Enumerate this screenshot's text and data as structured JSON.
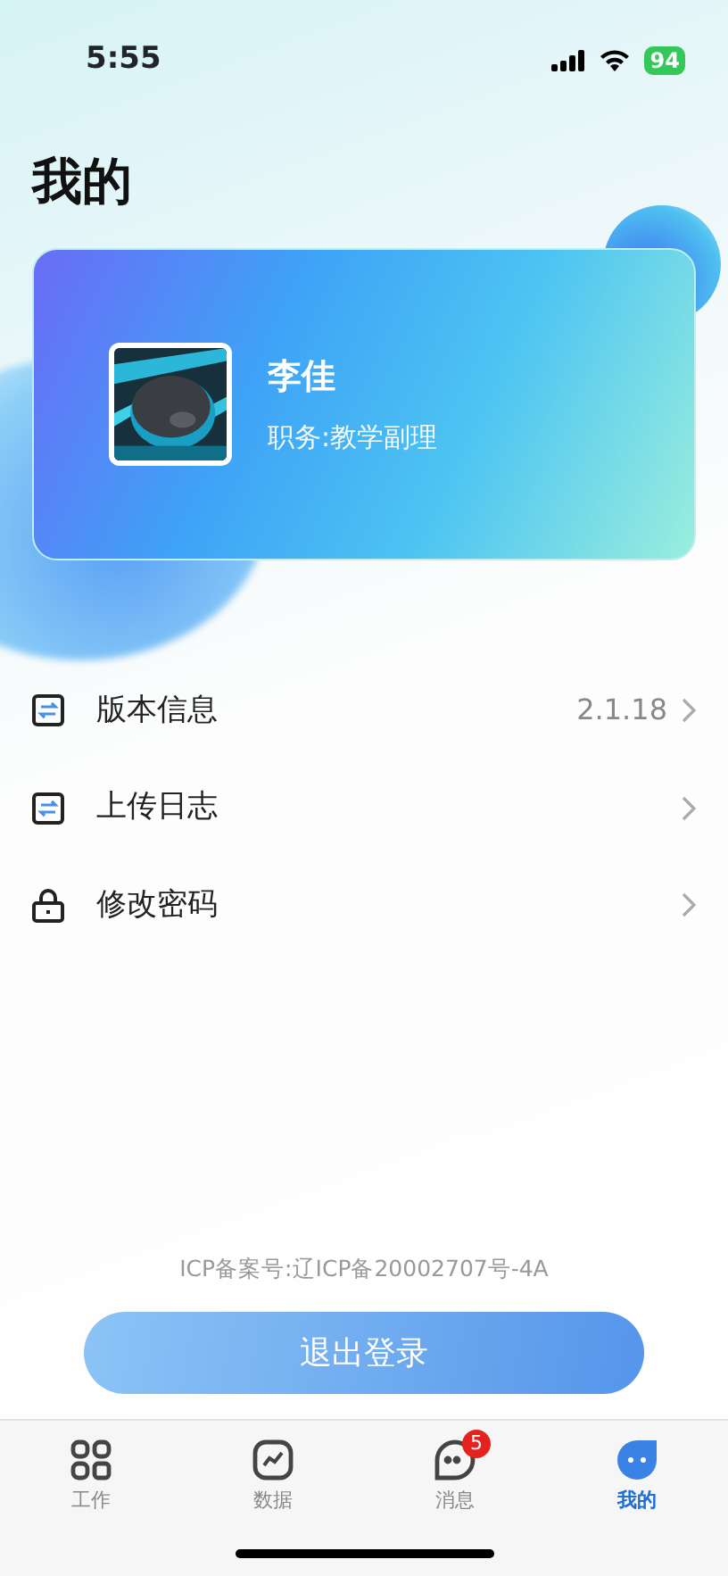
{
  "status_bar": {
    "time": "5:55",
    "battery": "94"
  },
  "page_title": "我的",
  "profile": {
    "name": "李佳",
    "role": "职务:教学副理"
  },
  "menu": [
    {
      "kind": "swap",
      "label": "版本信息",
      "value": "2.1.18"
    },
    {
      "kind": "swap",
      "label": "上传日志"
    },
    {
      "kind": "lock",
      "label": "修改密码"
    }
  ],
  "icp": "ICP备案号:辽ICP备20002707号-4A",
  "logout_button": "退出登录",
  "tabs": [
    {
      "kind": "grid",
      "label": "工作",
      "selected": false
    },
    {
      "kind": "chart",
      "label": "数据",
      "selected": false
    },
    {
      "kind": "chat",
      "label": "消息",
      "selected": false,
      "badge": "5"
    },
    {
      "kind": "bubble",
      "label": "我的",
      "selected": true
    }
  ]
}
